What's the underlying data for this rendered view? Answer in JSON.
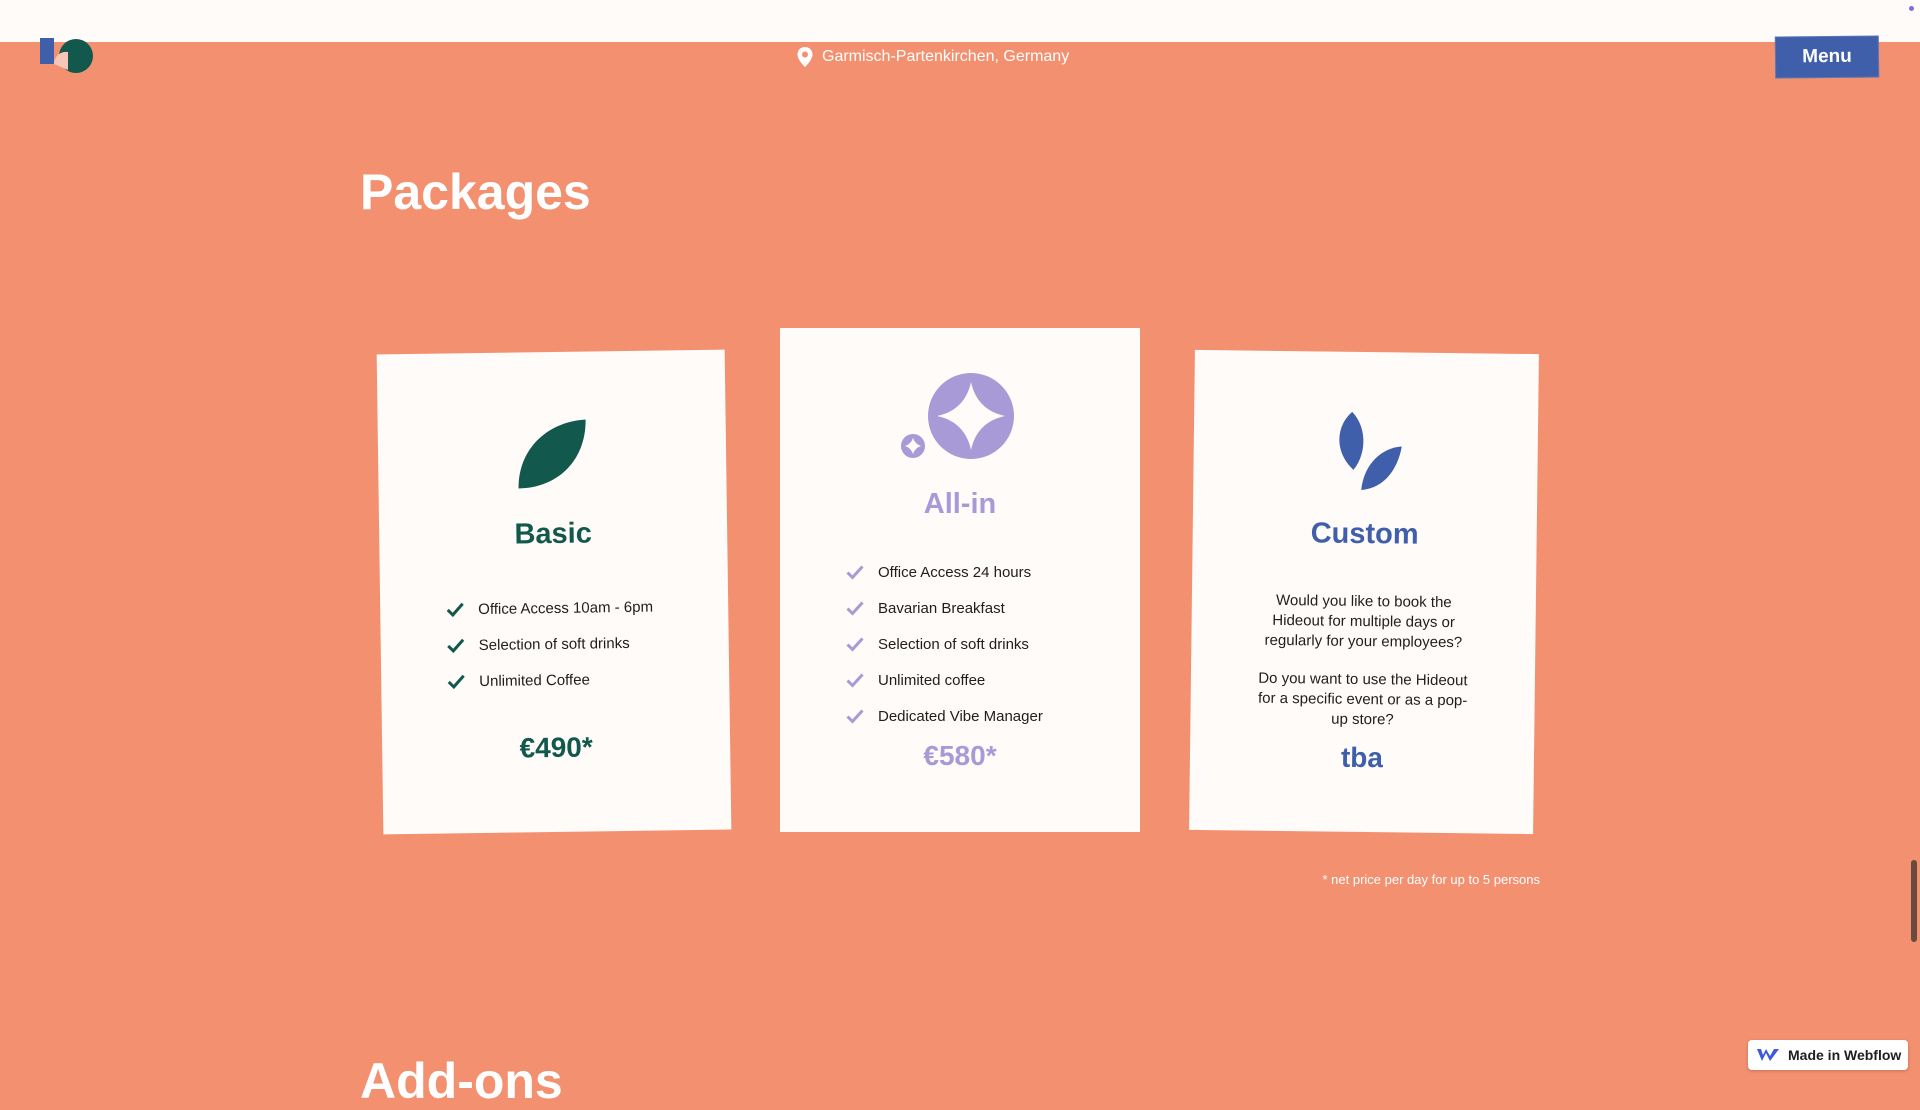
{
  "header": {
    "location": "Garmisch-Partenkirchen, Germany",
    "menu_label": "Menu"
  },
  "section": {
    "title": "Packages",
    "next_title": "Add-ons"
  },
  "packages": [
    {
      "name": "Basic",
      "icon": "leaf-icon",
      "features": [
        "Office Access 10am - 6pm",
        "Selection of soft drinks",
        "Unlimited Coffee"
      ],
      "price": "€490*"
    },
    {
      "name": "All-in",
      "icon": "sparkle-icon",
      "features": [
        "Office Access 24 hours",
        "Bavarian Breakfast",
        "Selection of soft drinks",
        "Unlimited coffee",
        "Dedicated Vibe Manager"
      ],
      "price": "€580*"
    },
    {
      "name": "Custom",
      "icon": "two-leaves-icon",
      "paragraph1": "Would you like to book the Hideout for multiple days or regularly for your employees?",
      "paragraph2": "Do you want to use the Hideout for a specific event or as a pop-up store?",
      "price": "tba"
    }
  ],
  "footnote": "* net price per day for up to 5 persons",
  "badge": {
    "label": "Made in Webflow"
  },
  "colors": {
    "background": "#f39070",
    "basic": "#13584c",
    "allin": "#a79ad6",
    "custom": "#3f5faa",
    "card": "#fefbf9"
  }
}
